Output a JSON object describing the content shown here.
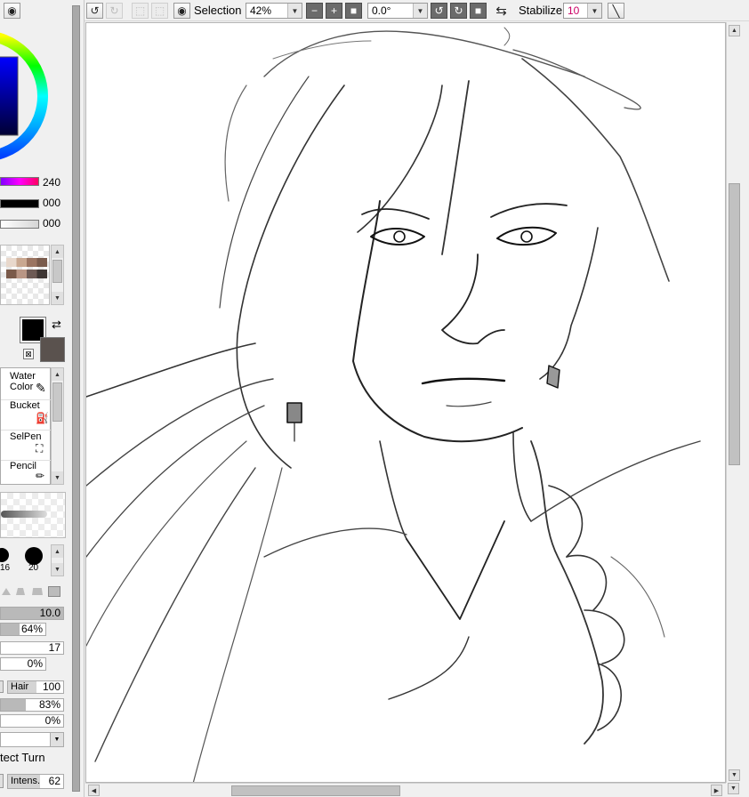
{
  "toolbar": {
    "selection_label": "Selection",
    "zoom": "42%",
    "rotation": "0.0°",
    "stabilizer_label": "Stabilizer",
    "stabilizer_value": "10"
  },
  "left_panel": {
    "color_values": [
      "240",
      "000",
      "000"
    ],
    "tools": [
      {
        "line1": "Water",
        "line2": "Color"
      },
      {
        "line1": "Bucket",
        "line2": ""
      },
      {
        "line1": "SelPen",
        "line2": ""
      },
      {
        "line1": "Pencil",
        "line2": ""
      }
    ],
    "brush_sizes": [
      "16",
      "20"
    ],
    "params": {
      "size": "10.0",
      "density": "64%",
      "p3": "17",
      "p4": "0%",
      "hair_label": "Hair",
      "hair_value": "100",
      "p6": "83%",
      "p7": "0%",
      "protect_label": "tect Turn",
      "intens_label": "Intens.",
      "intens_value": "62"
    }
  },
  "colors": {
    "primary": "#000000",
    "secondary": "#5a524e",
    "accent_text": "#cc0066"
  },
  "icons": [
    "undo-icon",
    "redo-icon",
    "eye-icon",
    "zoom-out-icon",
    "zoom-in-icon",
    "reset-icon",
    "rotate-left-icon",
    "rotate-right-icon",
    "swap-icon",
    "line-icon"
  ]
}
